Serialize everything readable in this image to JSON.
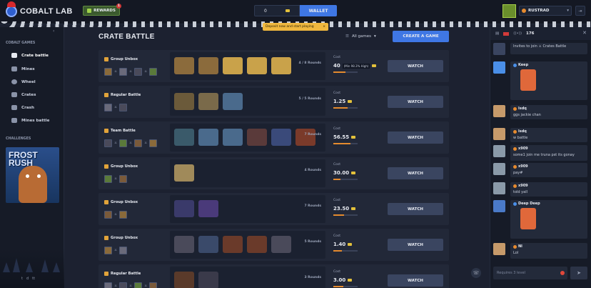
{
  "header": {
    "brand": "COBALT LAB",
    "rewards_label": "REWARDS",
    "rewards_badge": "1",
    "balance": "0",
    "wallet_label": "WALLET",
    "toast_text": "Deposit now and start playing",
    "toast_close": "×",
    "username": "RUSTRAD",
    "logout_icon": "⇥"
  },
  "sidebar": {
    "section_games": "COBALT GAMES",
    "items": [
      {
        "label": "Crate battle",
        "icon": "swords-icon",
        "active": true
      },
      {
        "label": "Mines",
        "icon": "mine-icon"
      },
      {
        "label": "Wheel",
        "icon": "wheel-icon"
      },
      {
        "label": "Crates",
        "icon": "crate-icon"
      },
      {
        "label": "Crash",
        "icon": "crash-icon"
      },
      {
        "label": "Mines battle",
        "icon": "mines-battle-icon"
      }
    ],
    "section_challenges": "CHALLENGES",
    "promo_title": "FROST\nRUSH",
    "social": [
      "t",
      "d",
      "tt"
    ]
  },
  "main": {
    "title": "CRATE BATTLE",
    "filter_label": "All games",
    "create_label": "CREATE A GAME",
    "rows": [
      {
        "mode": "Group Unbox",
        "rounds": "4 / 8 Rounds",
        "cost": "40",
        "roi": "(Min 98.3% High)",
        "watch": "WATCH",
        "progress": 0.5,
        "case_colors": [
          "#8b6b3c",
          "#8b6b3c",
          "#c9a24a",
          "#c9a24a",
          "#c9a24a"
        ]
      },
      {
        "mode": "Regular Battle",
        "rounds": "5 / 5 Rounds",
        "cost": "1.25",
        "watch": "WATCH",
        "progress": 0.6,
        "case_colors": [
          "#6b5a3a",
          "#7a6a4a",
          "#4a6a8c"
        ]
      },
      {
        "mode": "Team Battle",
        "rounds": "7 Rounds",
        "cost": "56.55",
        "watch": "WATCH",
        "progress": 0.7,
        "case_colors": [
          "#3a5a6a",
          "#4a6a8c",
          "#4a6a8c",
          "#5a3a3a",
          "#3a4a7a",
          "#7a3a2a"
        ]
      },
      {
        "mode": "Group Unbox",
        "rounds": "4 Rounds",
        "cost": "30.00",
        "watch": "WATCH",
        "progress": 0.3,
        "case_colors": [
          "#a08a5a"
        ]
      },
      {
        "mode": "Group Unbox",
        "rounds": "7 Rounds",
        "cost": "23.50",
        "watch": "WATCH",
        "progress": 0.45,
        "case_colors": [
          "#3a3a6a",
          "#4a3a7a"
        ]
      },
      {
        "mode": "Group Unbox",
        "rounds": "5 Rounds",
        "cost": "1.40",
        "watch": "WATCH",
        "progress": 0.35,
        "case_colors": [
          "#4a4a5a",
          "#3a4a6a",
          "#6a3a2a",
          "#6a3a2a",
          "#4a4a5a"
        ]
      },
      {
        "mode": "Regular Battle",
        "rounds": "3 Rounds",
        "cost": "3.00",
        "watch": "WATCH",
        "progress": 0.4,
        "case_colors": [
          "#5a3a2a",
          "#3a3a4a"
        ]
      }
    ],
    "cost_label": "Cost"
  },
  "chat": {
    "online": "176",
    "messages": [
      {
        "user": "",
        "text": "Invites to join ⚔ Crates Battle"
      },
      {
        "user": "Keep",
        "text": ""
      },
      {
        "user": "lsdq",
        "text": "ggs jackie chan"
      },
      {
        "user": "lsdq",
        "text": "w battle"
      },
      {
        "user": "x909",
        "text": "some1 join me truna pst its gonay"
      },
      {
        "user": "x909",
        "text": "pay#"
      },
      {
        "user": "x909",
        "text": "told yall"
      },
      {
        "user": "Deep Deep",
        "text": ""
      },
      {
        "user": "Nl",
        "text": "Lol"
      }
    ],
    "input_placeholder": "Requires 3 level",
    "send_icon": "➤"
  }
}
